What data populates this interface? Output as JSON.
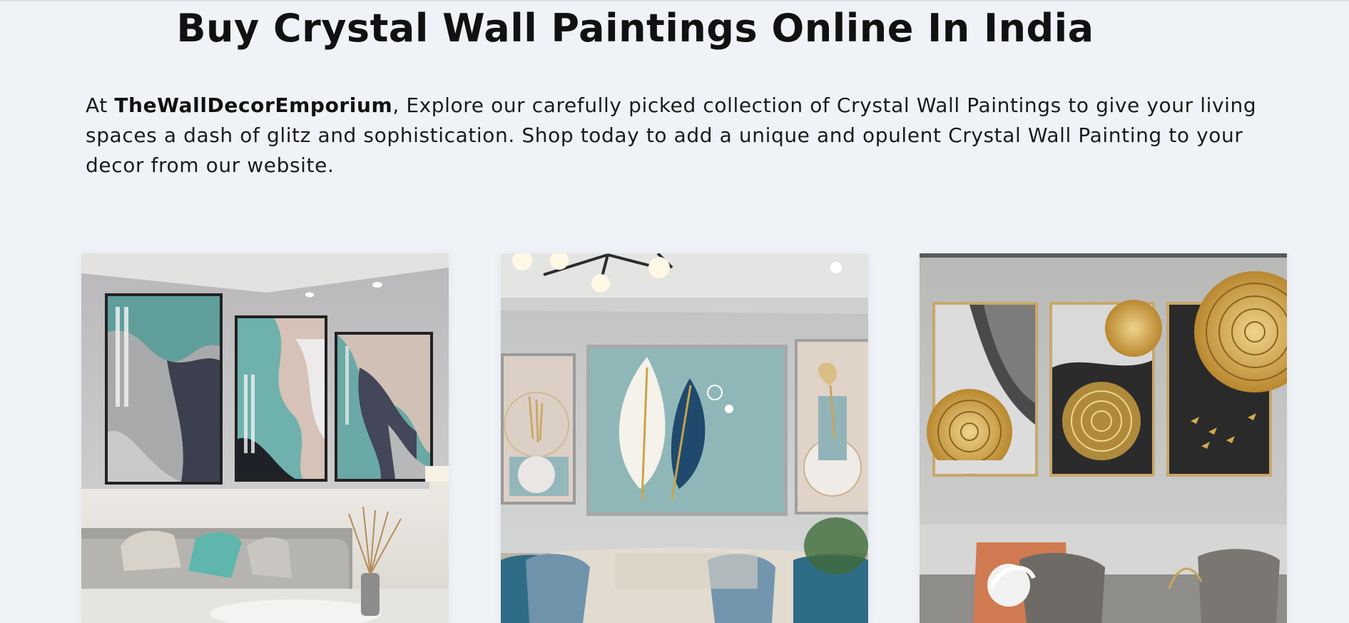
{
  "page": {
    "title": "Buy Crystal Wall Paintings Online In India",
    "intro": {
      "lead": "At ",
      "brand": "TheWallDecorEmporium",
      "body": ", Explore our carefully picked collection of Crystal Wall Paintings to give your living spaces a dash of glitz and sophistication. Shop today to add a unique and opulent Crystal Wall Painting to your decor from our website."
    }
  },
  "products": [
    {
      "image": "teal-grey-abstract-triptych-living-room"
    },
    {
      "image": "white-and-navy-leaves-crystal-painting-living-room"
    },
    {
      "image": "gold-tree-rings-triptych-living-room"
    }
  ],
  "colors": {
    "background": "#eff3f8",
    "heading": "#111111"
  }
}
